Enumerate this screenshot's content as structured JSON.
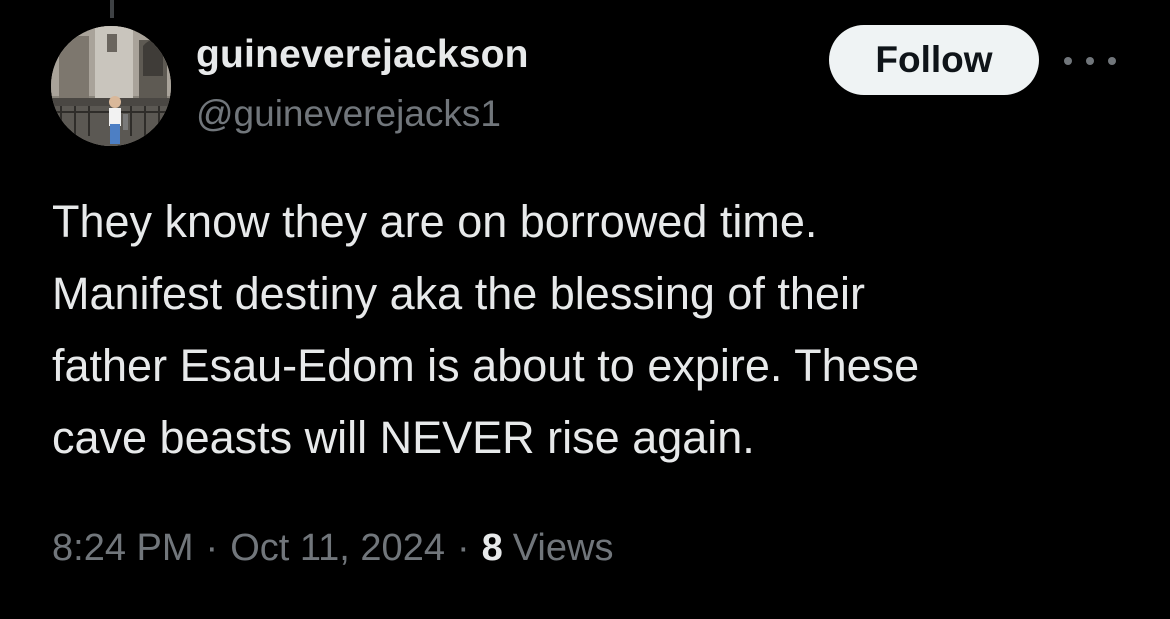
{
  "author": {
    "display_name": "guineverejackson",
    "handle": "@guineverejacks1",
    "avatar_alt": "profile photo"
  },
  "actions": {
    "follow_label": "Follow",
    "more_icon": "more-horizontal-icon"
  },
  "tweet": {
    "lines": [
      "They know they are on borrowed time.",
      "Manifest destiny aka the blessing of their",
      "father Esau-Edom is about to expire. These",
      "cave beasts will NEVER rise again."
    ]
  },
  "meta": {
    "time": "8:24 PM",
    "separator": "·",
    "date": "Oct 11, 2024",
    "views_count": "8",
    "views_label": "Views"
  },
  "colors": {
    "background": "#000000",
    "primary_text": "#e7e9ea",
    "secondary_text": "#71767b",
    "follow_bg": "#eff3f4",
    "follow_text": "#0f1419"
  }
}
